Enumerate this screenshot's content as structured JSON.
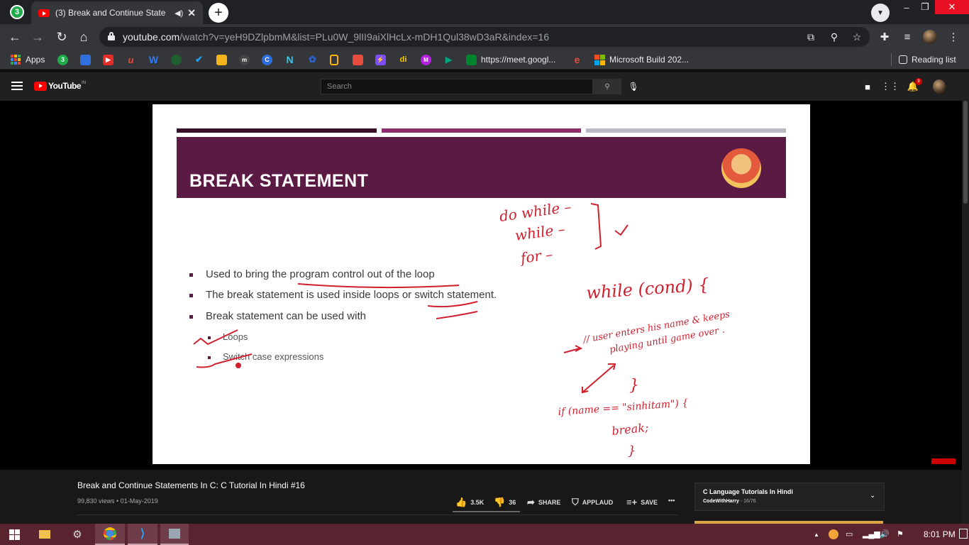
{
  "browser": {
    "whatsapp_badge": "3",
    "tab_title": "(3) Break and Continue State",
    "tab_close": "✕",
    "newtab": "+",
    "url_host": "youtube.com",
    "url_path": "/watch?v=yeH9DZlpbmM&list=PLu0W_9lII9aiXlHcLx-mDH1Qul38wD3aR&index=16",
    "win_min": "–",
    "win_max": "❐",
    "win_close": "✕"
  },
  "bookmarks": {
    "apps_label": "Apps",
    "whatsapp_badge": "3",
    "meet_label": "https://meet.googl...",
    "msbuild_label": "Microsoft Build 202...",
    "reading_list": "Reading list",
    "item_colors": [
      "#1faa4b",
      "#2f6fde",
      "#e52d27",
      "#c0392b",
      "#3b5bdb",
      "#1e8e3e",
      "#1da1f2",
      "#f2b31b",
      "#555555",
      "#2d6cdf",
      "#36c5f0",
      "#2b65d9",
      "#ffb300",
      "#e74c3c",
      "#7c4dff",
      "#ffcc00",
      "#b620e0",
      "#00a67e",
      "#f4b400"
    ]
  },
  "youtube": {
    "logo_word": "YouTube",
    "country": "IN",
    "search_placeholder": "Search",
    "notification_count": "9"
  },
  "slide": {
    "title": "BREAK STATEMENT",
    "bar_colors": [
      "#3a0f2b",
      "#8a2f6a",
      "#b8bcc2"
    ],
    "bullets": [
      "Used to bring the program control out of the loop",
      "The break statement is used inside loops or switch statement.",
      "Break statement can be used with"
    ],
    "sub_bullets": [
      "Loops",
      "Switch case expressions"
    ],
    "handwriting": {
      "loops": [
        "do while –",
        "while –",
        "for –"
      ],
      "while_cond": "while (cond) {",
      "comment_1": "// user enters his name & keeps",
      "comment_2": "playing until game over .",
      "close_brace_1": "}",
      "if_line": "if (name == \"sinhitam\") {",
      "break_line": "break;",
      "close_brace_2": "}"
    }
  },
  "video": {
    "title": "Break and Continue Statements In C: C Tutorial In Hindi #16",
    "meta": "99,830 views • 01-May-2019",
    "likes": "3.5K",
    "dislikes": "36",
    "share": "SHARE",
    "applaud": "APPLAUD",
    "save": "SAVE",
    "more": "•••"
  },
  "playlist": {
    "title": "C Language Tutorials In Hindi",
    "channel": "CodeWithHarry",
    "position": " - 16/76",
    "chevron": "⌄"
  },
  "taskbar": {
    "time": "8:01 PM",
    "tray_up": "▲"
  }
}
